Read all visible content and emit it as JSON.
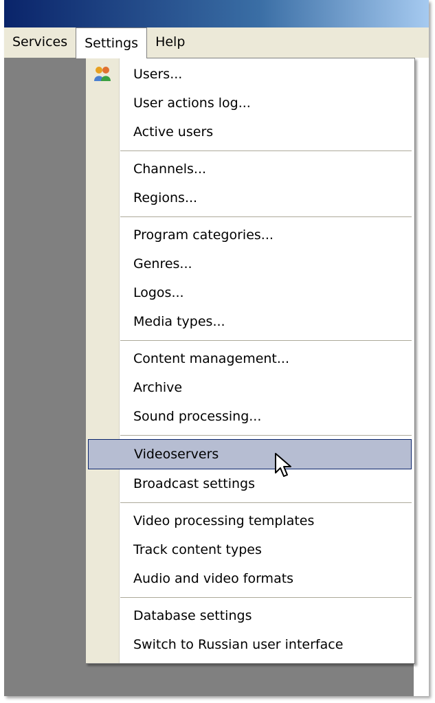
{
  "menubar": {
    "items": [
      {
        "label": "Services"
      },
      {
        "label": "Settings"
      },
      {
        "label": "Help"
      }
    ]
  },
  "settings_menu": {
    "groups": [
      [
        {
          "label": "Users...",
          "icon": "users-icon"
        },
        {
          "label": "User actions log..."
        },
        {
          "label": "Active users"
        }
      ],
      [
        {
          "label": "Channels..."
        },
        {
          "label": "Regions..."
        }
      ],
      [
        {
          "label": "Program categories..."
        },
        {
          "label": "Genres..."
        },
        {
          "label": "Logos..."
        },
        {
          "label": "Media types..."
        }
      ],
      [
        {
          "label": "Content management..."
        },
        {
          "label": "Archive"
        },
        {
          "label": "Sound processing..."
        }
      ],
      [
        {
          "label": "Videoservers",
          "highlighted": true
        },
        {
          "label": "Broadcast settings"
        }
      ],
      [
        {
          "label": "Video processing templates"
        },
        {
          "label": "Track content types"
        },
        {
          "label": "Audio and video formats"
        }
      ],
      [
        {
          "label": "Database settings"
        },
        {
          "label": "Switch to Russian user interface"
        }
      ]
    ]
  },
  "colors": {
    "menu_background": "#ece9d8",
    "highlight": "#b6bdd2",
    "highlight_border": "#0a246a",
    "workspace": "#808080"
  }
}
